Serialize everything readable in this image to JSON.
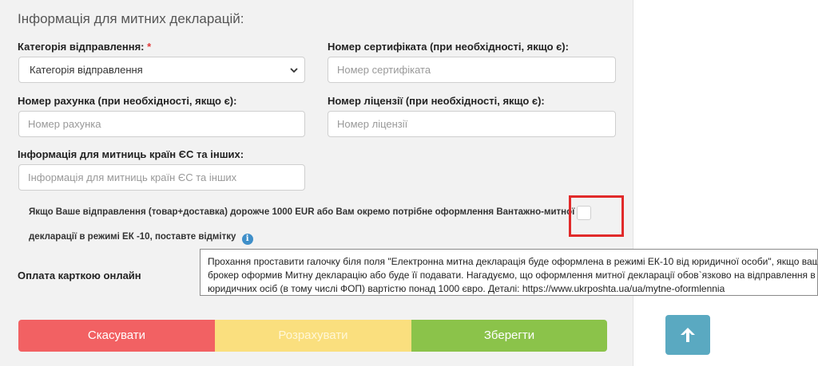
{
  "section": {
    "title": "Інформація для митних декларацій:"
  },
  "fields": {
    "category": {
      "label": "Категорія відправлення:",
      "required_mark": "*",
      "value": "Категорія відправлення"
    },
    "certificate": {
      "label": "Номер сертифіката (при необхідності, якщо є):",
      "placeholder": "Номер сертифіката"
    },
    "invoice": {
      "label": "Номер рахунка (при необхідності, якщо є):",
      "placeholder": "Номер рахунка"
    },
    "license": {
      "label": "Номер ліцензії (при необхідності, якщо є):",
      "placeholder": "Номер ліцензії"
    },
    "eu_info": {
      "label": "Інформація для митниць країн ЄС та інших:",
      "placeholder": "Інформація для митниць країн ЄС та інших"
    }
  },
  "declaration": {
    "line1": "Якщо Ваше відправлення (товар+доставка) дорожче 1000 EUR або Вам окремо потрібне оформлення Вантажно-митної",
    "line2": "декларації в режимі ЕК -10, поставте відмітку",
    "info_icon": "i",
    "checked": false
  },
  "payment": {
    "label": "Оплата карткою онлайн"
  },
  "tooltip": {
    "line1": "Прохання проставити галочку біля поля \"Електронна митна декларація буде оформлена в режимі ЕК-10 від юридичної особи\", якщо ваш",
    "line2": "брокер оформив Митну декларацію або буде її подавати. Нагадуємо, що оформлення митної декларації обов`язково на відправлення в",
    "line3": "юридичних осіб (в тому числі ФОП) вартістю понад 1000 євро. Деталі: https://www.ukrposhta.ua/ua/mytne-oformlennia"
  },
  "buttons": {
    "cancel": "Скасувати",
    "calculate": "Розрахувати",
    "save": "Зберегти"
  },
  "icons": {
    "scroll_up": "arrow-up-icon",
    "info": "info-icon",
    "dropdown": "chevron-down-icon"
  },
  "colors": {
    "highlight": "#e12a2a",
    "cancel": "#f26163",
    "calculate": "#fadf7e",
    "save": "#8bc34a",
    "scroll_up": "#5aa9c1"
  }
}
